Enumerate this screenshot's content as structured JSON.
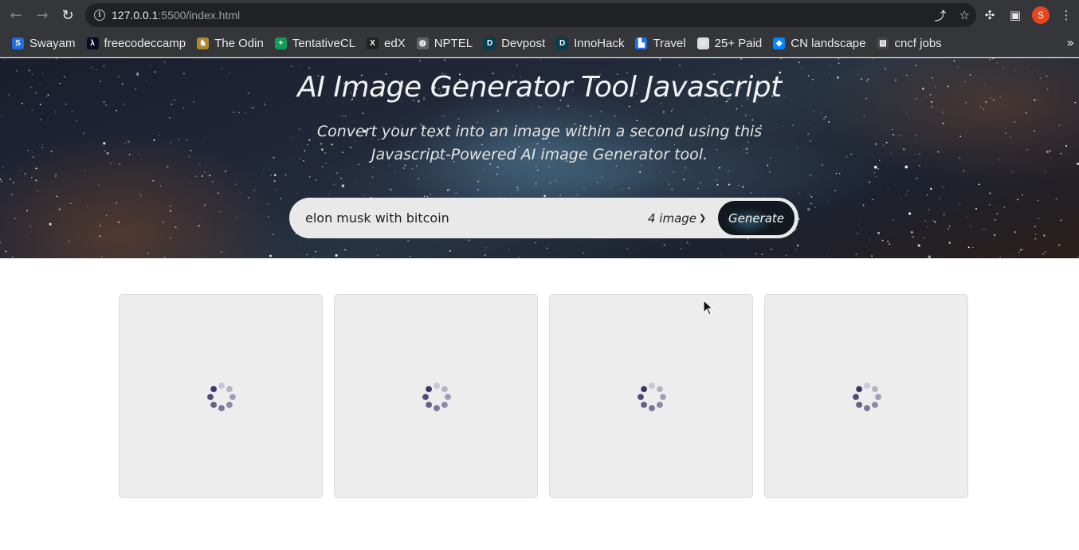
{
  "browser": {
    "url_host": "127.0.0.1",
    "url_path": ":5500/index.html",
    "profile_initial": "S",
    "bookmarks": [
      {
        "label": "Swayam",
        "icon": "swayam-icon",
        "color": "#1f6fe0"
      },
      {
        "label": "freecodeccamp",
        "icon": "freecodecamp-icon",
        "color": "#0a0a23"
      },
      {
        "label": "The Odin",
        "icon": "odin-icon",
        "color": "#b0862f"
      },
      {
        "label": "TentativeCL",
        "icon": "sheets-icon",
        "color": "#0f9d58"
      },
      {
        "label": "edX",
        "icon": "edx-icon",
        "color": "#222222"
      },
      {
        "label": "NPTEL",
        "icon": "globe-icon",
        "color": "#5f6368"
      },
      {
        "label": "Devpost",
        "icon": "devpost-icon",
        "color": "#003e54"
      },
      {
        "label": "InnoHack",
        "icon": "devpost-icon",
        "color": "#003e54"
      },
      {
        "label": "Travel",
        "icon": "travel-icon",
        "color": "#1a73e8"
      },
      {
        "label": "25+ Paid",
        "icon": "doc-icon",
        "color": "#dadce0"
      },
      {
        "label": "CN landscape",
        "icon": "cncf-icon",
        "color": "#0086ff"
      },
      {
        "label": "cncf jobs",
        "icon": "cncf-jobs-icon",
        "color": "#444444"
      }
    ]
  },
  "hero": {
    "title": "AI Image Generator Tool Javascript",
    "subtitle": "Convert your text into an image within a second using this Javascript-Powered AI image Generator tool."
  },
  "form": {
    "prompt_value": "elon musk with bitcoin",
    "quantity_selected": "4 image",
    "generate_label": "Generate"
  },
  "gallery": {
    "cards": [
      {
        "state": "loading"
      },
      {
        "state": "loading"
      },
      {
        "state": "loading"
      },
      {
        "state": "loading"
      }
    ]
  },
  "colors": {
    "chrome_bg": "#35363a",
    "omnibox_bg": "#202124",
    "form_bg": "#e9e9ea",
    "card_bg": "#ededed",
    "spinner_dark": "#3e3566",
    "spinner_light": "#c9c7d6"
  }
}
